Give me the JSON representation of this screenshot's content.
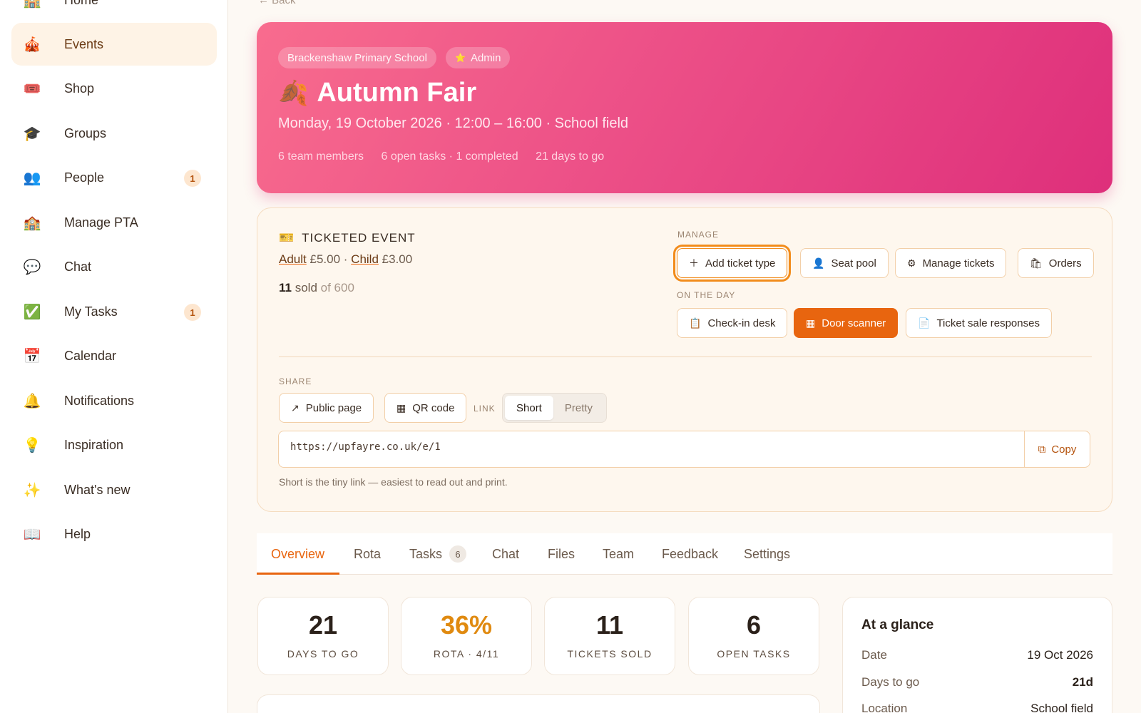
{
  "sidebar": {
    "items": [
      {
        "label": "Home",
        "icon": "school-icon",
        "glyph": "🏫"
      },
      {
        "label": "Events",
        "icon": "circus-tent-icon",
        "glyph": "🎪"
      },
      {
        "label": "Shop",
        "icon": "ticket-icon",
        "glyph": "🎟️"
      },
      {
        "label": "Groups",
        "icon": "graduation-cap-icon",
        "glyph": "🎓"
      },
      {
        "label": "People",
        "icon": "people-icon",
        "glyph": "👥",
        "badge": "1"
      },
      {
        "label": "Manage PTA",
        "icon": "school-icon",
        "glyph": "🏫"
      },
      {
        "label": "Chat",
        "icon": "speech-bubble-icon",
        "glyph": "💬"
      },
      {
        "label": "My Tasks",
        "icon": "check-box-icon",
        "glyph": "✅",
        "badge": "1"
      },
      {
        "label": "Calendar",
        "icon": "calendar-icon",
        "glyph": "📅"
      },
      {
        "label": "Notifications",
        "icon": "bell-icon",
        "glyph": "🔔"
      },
      {
        "label": "Inspiration",
        "icon": "lightbulb-icon",
        "glyph": "💡"
      },
      {
        "label": "What's new",
        "icon": "sparkles-icon",
        "glyph": "✨"
      },
      {
        "label": "Help",
        "icon": "book-icon",
        "glyph": "📖"
      }
    ],
    "active": "Events"
  },
  "back_label": "← Back",
  "hero": {
    "school": "Brackenshaw Primary School",
    "role": "Admin",
    "role_glyph": "⭐",
    "title_glyph": "🍂",
    "title": "Autumn Fair",
    "subtitle": "Monday, 19 October 2026 · 12:00 – 16:00 · School field",
    "team": "6 team members",
    "tasks": "6 open tasks · 1 completed",
    "countdown": "21 days to go"
  },
  "ticketing": {
    "heading": "TICKETED EVENT",
    "adult_label": "Adult",
    "adult_price": "£5.00",
    "sep": "·",
    "child_label": "Child",
    "child_price": "£3.00",
    "sold": "11",
    "sold_word": "sold",
    "capacity": "of 600",
    "manage_label": "MANAGE",
    "manage_buttons": [
      "Add ticket type",
      "Seat pool",
      "Manage tickets",
      "Orders"
    ],
    "day_label": "ON THE DAY",
    "day_buttons": [
      "Check-in desk",
      "Door scanner",
      "Ticket sale responses"
    ],
    "share_label": "SHARE",
    "public_page": "Public page",
    "qr_code": "QR code",
    "link_label": "LINK",
    "link_modes": [
      "Short",
      "Pretty"
    ],
    "link_mode_selected": "Short",
    "url": "https://upfayre.co.uk/e/1",
    "copy": "Copy",
    "hint": "Short is the tiny link — easiest to read out and print."
  },
  "tabs": [
    {
      "label": "Overview",
      "active": true
    },
    {
      "label": "Rota"
    },
    {
      "label": "Tasks",
      "count": "6"
    },
    {
      "label": "Chat"
    },
    {
      "label": "Files"
    },
    {
      "label": "Team"
    },
    {
      "label": "Feedback"
    },
    {
      "label": "Settings"
    }
  ],
  "stats": [
    {
      "value": "21",
      "label": "DAYS TO GO"
    },
    {
      "value": "36%",
      "label": "ROTA · 4/11"
    },
    {
      "value": "11",
      "label": "TICKETS SOLD"
    },
    {
      "value": "6",
      "label": "OPEN TASKS"
    }
  ],
  "glance": {
    "title": "At a glance",
    "rows": [
      {
        "key": "Date",
        "value": "19 Oct 2026"
      },
      {
        "key": "Days to go",
        "value": "21d"
      },
      {
        "key": "Location",
        "value": "School field"
      }
    ]
  },
  "colors": {
    "accent": "#e8650f",
    "hero_start": "#f86c8e",
    "hero_end": "#de2f7b",
    "stat_amber": "#e08a10"
  }
}
